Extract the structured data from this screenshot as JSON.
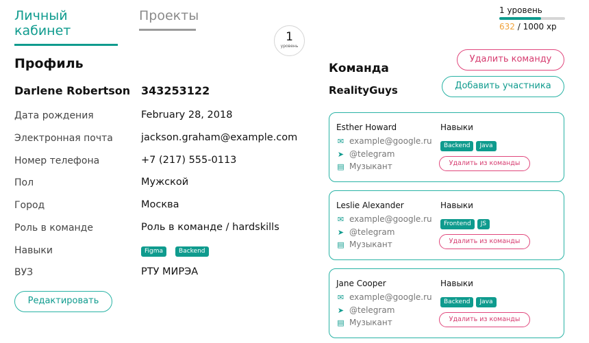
{
  "tabs": [
    {
      "label": "Личный кабинет"
    },
    {
      "label": "Проекты"
    }
  ],
  "level": {
    "number": "1",
    "label": "уровень",
    "title": "1 уровень",
    "xp_current": "632",
    "xp_total": "/ 1000 xp",
    "progress": 0.632
  },
  "profile": {
    "heading": "Профиль",
    "name": "Darlene Robertson",
    "id": "343253122",
    "rows": [
      {
        "label": "Дата рождения",
        "value": "February 28, 2018"
      },
      {
        "label": "Электронная почта",
        "value": "jackson.graham@example.com"
      },
      {
        "label": "Номер телефона",
        "value": "+7 (217) 555-0113"
      },
      {
        "label": "Пол",
        "value": "Мужской"
      },
      {
        "label": "Город",
        "value": "Москва"
      },
      {
        "label": "Роль в команде",
        "value": "Роль в команде / hardskills"
      },
      {
        "label": "Навыки",
        "value": ""
      },
      {
        "label": "ВУЗ",
        "value": "РТУ МИРЭА"
      }
    ],
    "skills": [
      "Figma",
      "Backend"
    ],
    "edit_button": "Редактировать"
  },
  "team": {
    "heading": "Команда",
    "name": "RealityGuys",
    "delete_button": "Удалить команду",
    "add_button": "Добавить участника",
    "members": [
      {
        "name": "Esther Howard",
        "email": "example@google.ru",
        "telegram": "@telegram",
        "role": "Музыкант",
        "skills_heading": "Навыки",
        "skills": [
          "Backend",
          "Java"
        ],
        "remove_button": "Удалить из команды"
      },
      {
        "name": "Leslie Alexander",
        "email": "example@google.ru",
        "telegram": "@telegram",
        "role": "Музыкант",
        "skills_heading": "Навыки",
        "skills": [
          "Frontend",
          "JS"
        ],
        "remove_button": "Удалить из команды"
      },
      {
        "name": "Jane Cooper",
        "email": "example@google.ru",
        "telegram": "@telegram",
        "role": "Музыкант",
        "skills_heading": "Навыки",
        "skills": [
          "Backend",
          "Java"
        ],
        "remove_button": "Удалить из команды"
      }
    ]
  },
  "icons": {
    "email": "mail-icon",
    "telegram": "send-icon",
    "role": "briefcase-icon"
  },
  "colors": {
    "accent": "#0f9b8e",
    "danger": "#d63b6f",
    "xp": "#f0a23a"
  }
}
